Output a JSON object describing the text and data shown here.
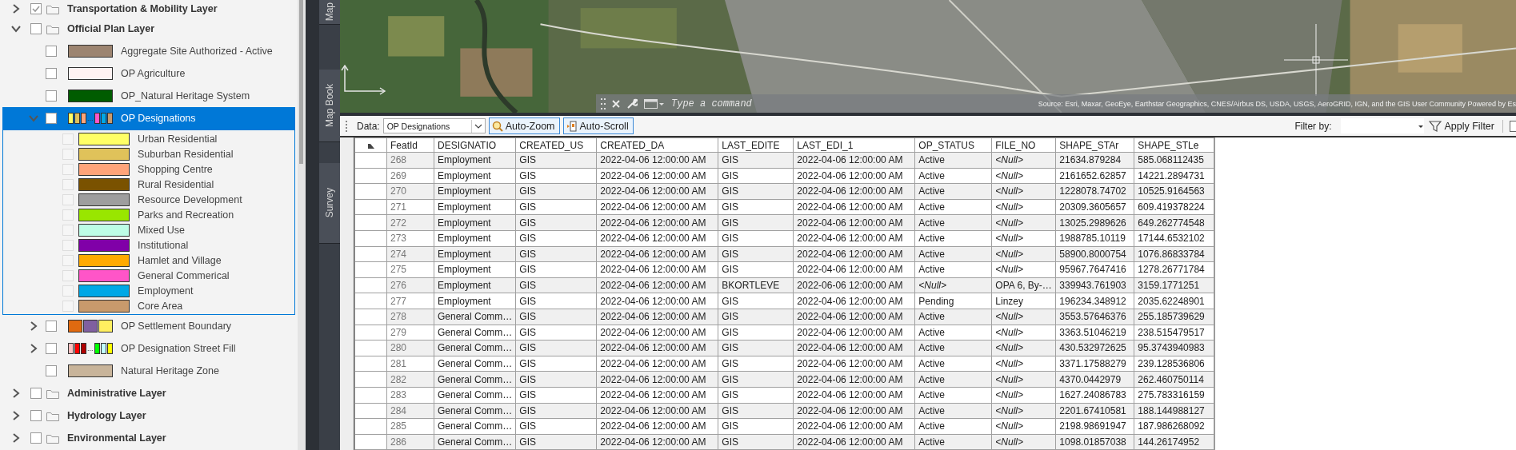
{
  "layers_panel": {
    "tree": [
      {
        "kind": "group",
        "name": "Transportation & Mobility Layer",
        "expanded": false,
        "checked": true,
        "selected": false
      },
      {
        "kind": "group",
        "name": "Official Plan Layer",
        "expanded": true,
        "checked": false,
        "selected": false,
        "children": [
          {
            "kind": "layer",
            "name": "Aggregate Site Authorized - Active",
            "checked": false,
            "selected": false,
            "color": "#9c8470"
          },
          {
            "kind": "layer",
            "name": "OP Agriculture",
            "checked": false,
            "selected": false,
            "color": "#fff2f2"
          },
          {
            "kind": "layer",
            "name": "OP_Natural Heritage System",
            "checked": false,
            "selected": false,
            "color": "#005c00"
          },
          {
            "kind": "layer",
            "name": "OP Designations",
            "expanded": true,
            "checked": false,
            "selected": true,
            "swatches": [
              {
                "color": "#ffff66"
              },
              {
                "color": "#e0c25a"
              },
              {
                "color": "#ffa47a"
              },
              {
                "color": "#ff55c8"
              },
              {
                "color": "#00a8e6"
              },
              {
                "color": "#c89a6c"
              }
            ],
            "ellipsis": "...",
            "children": [
              {
                "kind": "class",
                "name": "Urban Residential",
                "checked": false,
                "color": "#ffff66"
              },
              {
                "kind": "class",
                "name": "Suburban Residential",
                "checked": false,
                "color": "#e0c25a"
              },
              {
                "kind": "class",
                "name": "Shopping Centre",
                "checked": false,
                "color": "#ffa47a"
              },
              {
                "kind": "class",
                "name": "Rural Residential",
                "checked": false,
                "color": "#7a5200"
              },
              {
                "kind": "class",
                "name": "Resource Development",
                "checked": false,
                "color": "#9e9e9e"
              },
              {
                "kind": "class",
                "name": "Parks and Recreation",
                "checked": false,
                "color": "#99e600"
              },
              {
                "kind": "class",
                "name": "Mixed Use",
                "checked": false,
                "color": "#bdfde6"
              },
              {
                "kind": "class",
                "name": "Institutional",
                "checked": false,
                "color": "#8000a8"
              },
              {
                "kind": "class",
                "name": "Hamlet and Village",
                "checked": false,
                "color": "#ffaa00"
              },
              {
                "kind": "class",
                "name": "General Commerical",
                "checked": false,
                "color": "#ff55c8"
              },
              {
                "kind": "class",
                "name": "Employment",
                "checked": false,
                "color": "#00a8e6"
              },
              {
                "kind": "class",
                "name": "Core Area",
                "checked": false,
                "color": "#c89a6c"
              }
            ]
          },
          {
            "kind": "layer",
            "name": "OP Settlement Boundary",
            "expanded": false,
            "checked": false,
            "selected": false,
            "swatches": [
              {
                "color": "#e06a10"
              },
              {
                "color": "#8060a0"
              },
              {
                "color": "#ffef60"
              }
            ]
          },
          {
            "kind": "layer",
            "name": "OP Designation Street Fill",
            "expanded": false,
            "checked": false,
            "selected": false,
            "swatches": [
              {
                "color": "#ffc0c0"
              },
              {
                "color": "#ff0000"
              },
              {
                "color": "#b00000"
              },
              {
                "color": "#00ff00"
              },
              {
                "color": "#c0ffff"
              },
              {
                "color": "#ffff00"
              }
            ],
            "ellipsis": "..."
          },
          {
            "kind": "layer",
            "name": "Natural Heritage Zone",
            "checked": false,
            "selected": false,
            "color": "#c8b49a"
          }
        ]
      },
      {
        "kind": "group",
        "name": "Administrative Layer",
        "expanded": false,
        "checked": false,
        "selected": false
      },
      {
        "kind": "group",
        "name": "Hydrology Layer",
        "expanded": false,
        "checked": false,
        "selected": false
      },
      {
        "kind": "group",
        "name": "Environmental Layer",
        "expanded": false,
        "checked": false,
        "selected": false
      }
    ]
  },
  "side_tabs": [
    {
      "label": "Map"
    },
    {
      "label": "Map Book"
    },
    {
      "label": "Survey"
    }
  ],
  "map": {
    "kind": "picture",
    "command_line": {
      "placeholder": "Type a command"
    },
    "attribution": "Source: Esri, Maxar, GeoEye, Earthstar Geographics, CNES/Airbus DS, USDA, USGS, AeroGRID, IGN, and the GIS User Community Powered by Es"
  },
  "toolbar": {
    "data_label": "Data:",
    "data_value": "OP Designations",
    "buttons": [
      "Auto-Zoom",
      "Auto-Scroll"
    ],
    "filter_label": "Filter by:",
    "apply_button": "Apply Filter"
  },
  "table": {
    "columns": [
      "FeatId",
      "DESIGNATIO",
      "CREATED_US",
      "CREATED_DA",
      "LAST_EDITE",
      "LAST_EDI_1",
      "OP_STATUS",
      "FILE_NO",
      "SHAPE_STAr",
      "SHAPE_STLe"
    ],
    "rows": [
      [
        "268",
        "Employment",
        "GIS",
        "2022-04-06 12:00:00 AM",
        "GIS",
        "2022-04-06 12:00:00 AM",
        "Active",
        {
          "kind": "null",
          "text": "<Null>"
        },
        "21634.879284",
        "585.068112435"
      ],
      [
        "269",
        "Employment",
        "GIS",
        "2022-04-06 12:00:00 AM",
        "GIS",
        "2022-04-06 12:00:00 AM",
        "Active",
        {
          "kind": "null",
          "text": "<Null>"
        },
        "2161652.62857",
        "14221.2894731"
      ],
      [
        "270",
        "Employment",
        "GIS",
        "2022-04-06 12:00:00 AM",
        "GIS",
        "2022-04-06 12:00:00 AM",
        "Active",
        {
          "kind": "null",
          "text": "<Null>"
        },
        "1228078.74702",
        "10525.9164563"
      ],
      [
        "271",
        "Employment",
        "GIS",
        "2022-04-06 12:00:00 AM",
        "GIS",
        "2022-04-06 12:00:00 AM",
        "Active",
        {
          "kind": "null",
          "text": "<Null>"
        },
        "20309.3605657",
        "609.419378224"
      ],
      [
        "272",
        "Employment",
        "GIS",
        "2022-04-06 12:00:00 AM",
        "GIS",
        "2022-04-06 12:00:00 AM",
        "Active",
        {
          "kind": "null",
          "text": "<Null>"
        },
        "13025.2989626",
        "649.262774548"
      ],
      [
        "273",
        "Employment",
        "GIS",
        "2022-04-06 12:00:00 AM",
        "GIS",
        "2022-04-06 12:00:00 AM",
        "Active",
        {
          "kind": "null",
          "text": "<Null>"
        },
        "1988785.10119",
        "17144.6532102"
      ],
      [
        "274",
        "Employment",
        "GIS",
        "2022-04-06 12:00:00 AM",
        "GIS",
        "2022-04-06 12:00:00 AM",
        "Active",
        {
          "kind": "null",
          "text": "<Null>"
        },
        "58900.8000754",
        "1076.86833784"
      ],
      [
        "275",
        "Employment",
        "GIS",
        "2022-04-06 12:00:00 AM",
        "GIS",
        "2022-04-06 12:00:00 AM",
        "Active",
        {
          "kind": "null",
          "text": "<Null>"
        },
        "95967.7647416",
        "1278.26771784"
      ],
      [
        "276",
        "Employment",
        "GIS",
        "2022-04-06 12:00:00 AM",
        "BKORTLEVE",
        "2022-06-06 12:00:00 AM",
        {
          "kind": "null",
          "text": "<Null>"
        },
        "OPA 6, By-…",
        "339943.761903",
        "3159.1771251"
      ],
      [
        "277",
        "Employment",
        "GIS",
        "2022-04-06 12:00:00 AM",
        "GIS",
        "2022-04-06 12:00:00 AM",
        "Pending",
        "Linzey",
        "196234.348912",
        "2035.62248901"
      ],
      [
        "278",
        "General Comm…",
        "GIS",
        "2022-04-06 12:00:00 AM",
        "GIS",
        "2022-04-06 12:00:00 AM",
        "Active",
        {
          "kind": "null",
          "text": "<Null>"
        },
        "3553.57646376",
        "255.185739629"
      ],
      [
        "279",
        "General Comm…",
        "GIS",
        "2022-04-06 12:00:00 AM",
        "GIS",
        "2022-04-06 12:00:00 AM",
        "Active",
        {
          "kind": "null",
          "text": "<Null>"
        },
        "3363.51046219",
        "238.515479517"
      ],
      [
        "280",
        "General Comm…",
        "GIS",
        "2022-04-06 12:00:00 AM",
        "GIS",
        "2022-04-06 12:00:00 AM",
        "Active",
        {
          "kind": "null",
          "text": "<Null>"
        },
        "430.532972625",
        "95.3743940983"
      ],
      [
        "281",
        "General Comm…",
        "GIS",
        "2022-04-06 12:00:00 AM",
        "GIS",
        "2022-04-06 12:00:00 AM",
        "Active",
        {
          "kind": "null",
          "text": "<Null>"
        },
        "3371.17588279",
        "239.128536806"
      ],
      [
        "282",
        "General Comm…",
        "GIS",
        "2022-04-06 12:00:00 AM",
        "GIS",
        "2022-04-06 12:00:00 AM",
        "Active",
        {
          "kind": "null",
          "text": "<Null>"
        },
        "4370.0442979",
        "262.460750114"
      ],
      [
        "283",
        "General Comm…",
        "GIS",
        "2022-04-06 12:00:00 AM",
        "GIS",
        "2022-04-06 12:00:00 AM",
        "Active",
        {
          "kind": "null",
          "text": "<Null>"
        },
        "1627.24086783",
        "275.783316159"
      ],
      [
        "284",
        "General Comm…",
        "GIS",
        "2022-04-06 12:00:00 AM",
        "GIS",
        "2022-04-06 12:00:00 AM",
        "Active",
        {
          "kind": "null",
          "text": "<Null>"
        },
        "2201.67410581",
        "188.144988127"
      ],
      [
        "285",
        "General Comm…",
        "GIS",
        "2022-04-06 12:00:00 AM",
        "GIS",
        "2022-04-06 12:00:00 AM",
        "Active",
        {
          "kind": "null",
          "text": "<Null>"
        },
        "2198.98691947",
        "187.986268092"
      ],
      [
        "286",
        "General Comm…",
        "GIS",
        "2022-04-06 12:00:00 AM",
        "GIS",
        "2022-04-06 12:00:00 AM",
        "Active",
        {
          "kind": "null",
          "text": "<Null>"
        },
        "1098.01857038",
        "144.26174952"
      ]
    ]
  }
}
